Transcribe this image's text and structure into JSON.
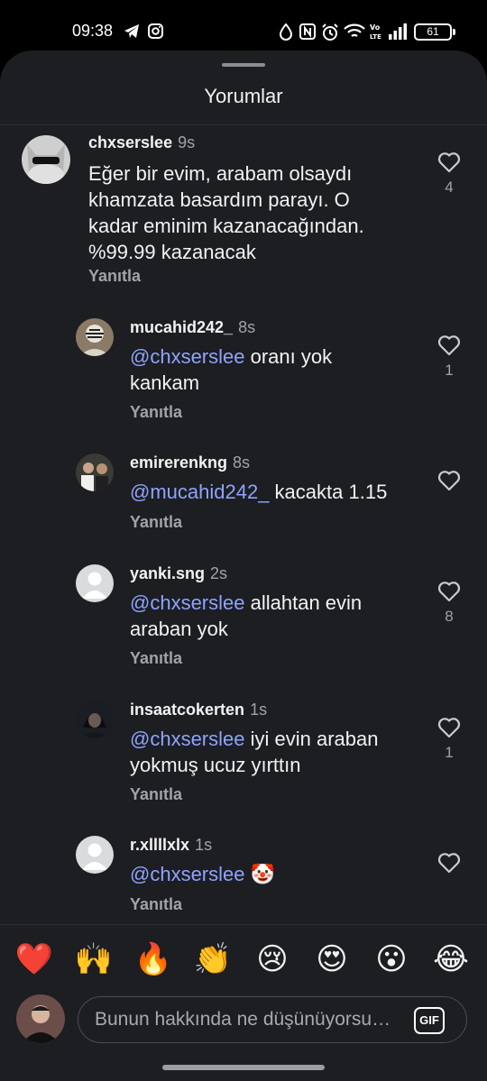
{
  "status_bar": {
    "time": "09:38",
    "battery": "61",
    "icons": [
      "telegram-icon",
      "instagram-icon",
      "drop-icon",
      "nfc-icon",
      "alarm-icon",
      "wifi-icon",
      "volte-icon",
      "signal-icon"
    ]
  },
  "sheet": {
    "title": "Yorumlar"
  },
  "comments": [
    {
      "username": "chxserslee",
      "time": "9s",
      "text_lines": [
        "Eğer bir evim, arabam olsaydı",
        "khamzata basardım parayı. O",
        "kadar eminim kazanacağından.",
        "%99.99 kazanacak"
      ],
      "reply_label": "Yanıtla",
      "likes": "4"
    },
    {
      "username": "mucahid242_",
      "time": "8s",
      "mention": "@chxserslee",
      "text_lines": [
        " oranı yok",
        "kankam"
      ],
      "reply_label": "Yanıtla",
      "likes": "1"
    },
    {
      "username": "emirerenkng",
      "time": "8s",
      "mention": "@mucahid242_",
      "text_lines": [
        " kacakta 1.15"
      ],
      "reply_label": "Yanıtla",
      "likes": ""
    },
    {
      "username": "yanki.sng",
      "time": "2s",
      "mention": "@chxserslee",
      "text_lines": [
        " allahtan evin",
        "araban yok"
      ],
      "reply_label": "Yanıtla",
      "likes": "8"
    },
    {
      "username": "insaatcokerten",
      "time": "1s",
      "mention": "@chxserslee",
      "text_lines": [
        " iyi evin araban",
        "yokmuş ucuz yırttın"
      ],
      "reply_label": "Yanıtla",
      "likes": "1"
    },
    {
      "username": "r.xllllxlx",
      "time": "1s",
      "mention": "@chxserslee",
      "text_lines": [
        " 🤡"
      ],
      "reply_label": "Yanıtla",
      "likes": ""
    }
  ],
  "emoji_bar": [
    "❤️",
    "🙌",
    "🔥",
    "👏",
    "😢",
    "😍",
    "😮",
    "😂"
  ],
  "composer": {
    "placeholder": "Bunun hakkında ne düşünüyorsun?",
    "gif_label": "GIF"
  },
  "colors": {
    "background": "#1c1e21",
    "mention": "#8fa3ff",
    "muted": "#a0a3a8"
  }
}
